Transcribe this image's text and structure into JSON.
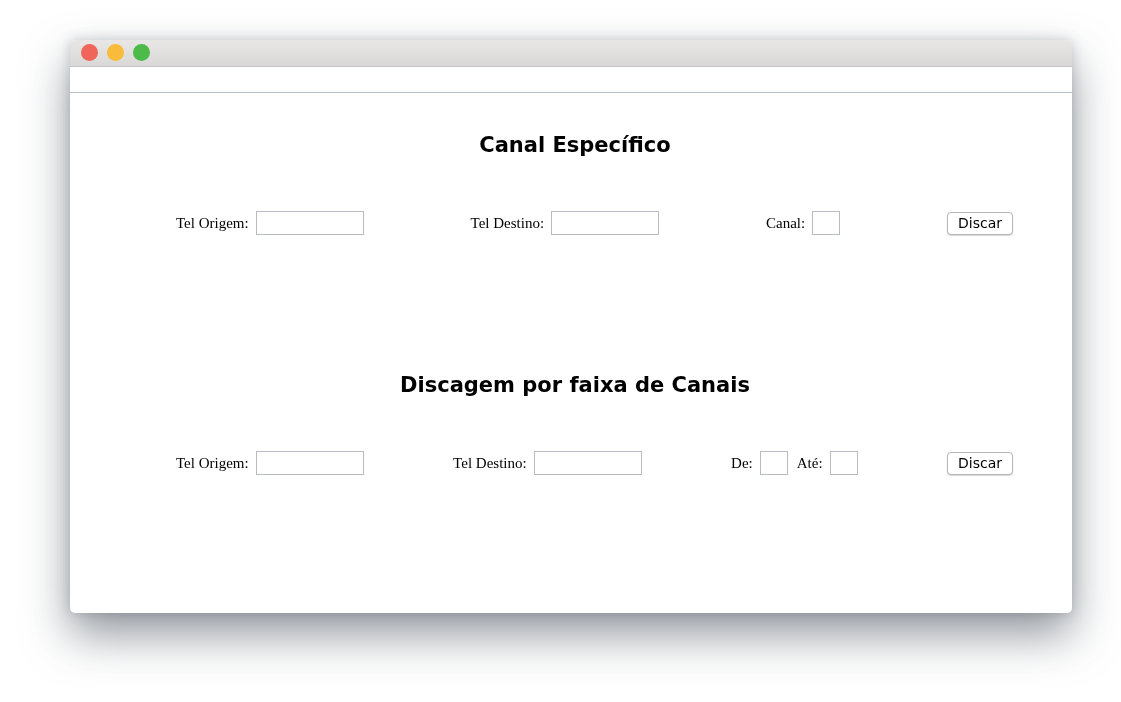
{
  "sections": [
    {
      "title": "Canal Específico",
      "fields": [
        {
          "label": "Tel Origem:",
          "kind": "wide"
        },
        {
          "label": "Tel Destino:",
          "kind": "wide"
        },
        {
          "label": "Canal:",
          "kind": "narrow"
        }
      ],
      "button": "Discar"
    },
    {
      "title": "Discagem por faixa de Canais",
      "fields": [
        {
          "label": "Tel Origem:",
          "kind": "wide"
        },
        {
          "label": "Tel Destino:",
          "kind": "wide"
        },
        {
          "label": "De:",
          "kind": "narrow"
        },
        {
          "label": "Até:",
          "kind": "narrow"
        }
      ],
      "button": "Discar"
    }
  ]
}
